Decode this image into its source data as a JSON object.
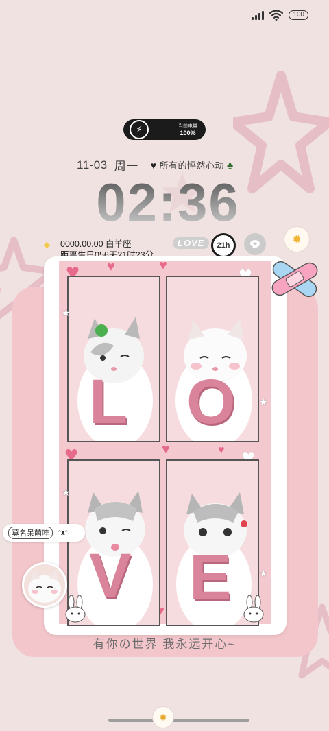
{
  "status_bar": {
    "battery_level": "100"
  },
  "charging": {
    "label": "当前电量",
    "percent": "100%"
  },
  "lockscreen": {
    "date": "11-03",
    "weekday": "周一",
    "mood_text": "所有的怦然心动",
    "time": "02:36"
  },
  "info": {
    "birthday_line1": "0000.00.00 白羊座",
    "birthday_line2": "距离生日056天21时23分",
    "love_label": "LOVE",
    "hours_label": "21h"
  },
  "card": {
    "letters": [
      "L",
      "O",
      "V",
      "E"
    ],
    "name_chip": "莫名呆萌哇",
    "name_chip_face": "ᵔᴥᵔ·"
  },
  "caption": "有你の世界 我永远开心~",
  "colors": {
    "background": "#f1e2e2",
    "card_pink": "#f2c6cb",
    "letter_pink": "#d9849a",
    "heart_pink": "#e86a8a"
  },
  "icons": [
    "signal-icon",
    "wifi-icon",
    "battery-icon",
    "bolt-icon",
    "heart-icon",
    "clover-icon",
    "sparkle-icon",
    "chat-icon",
    "sun-icon",
    "bandaid-icon",
    "star-icon",
    "bunny-icon"
  ]
}
